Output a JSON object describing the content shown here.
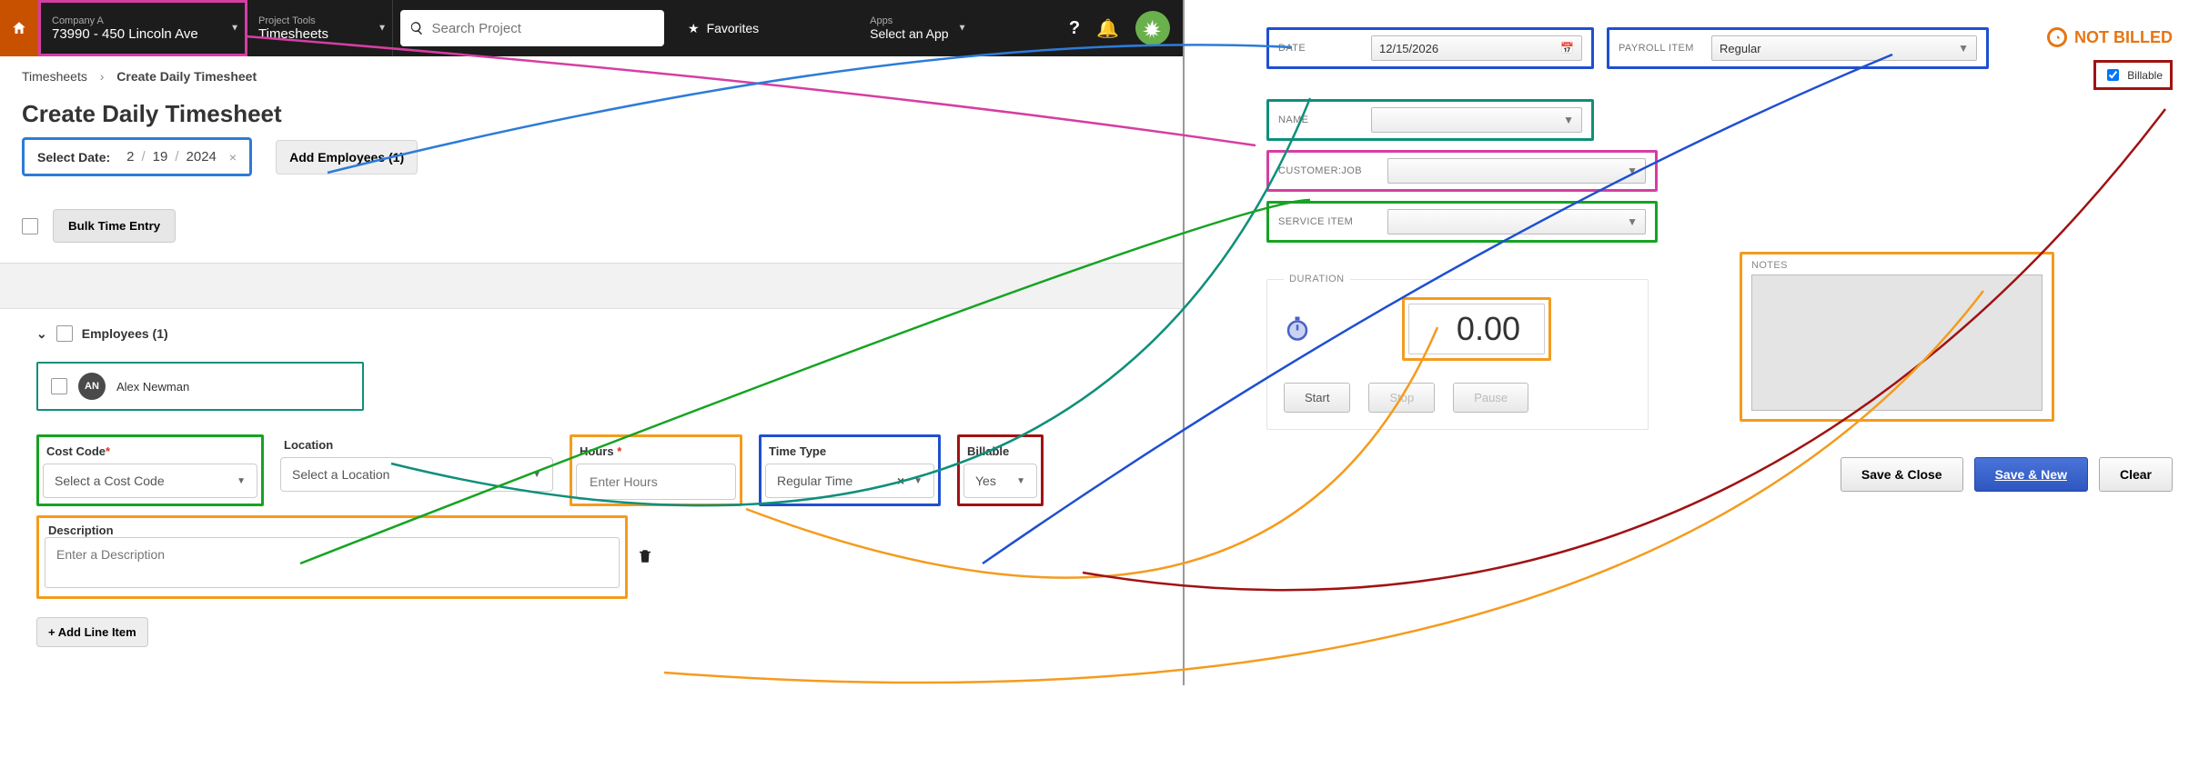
{
  "nav": {
    "company": {
      "small": "Company A",
      "big": "73990 - 450 Lincoln Ave"
    },
    "tools": {
      "small": "Project Tools",
      "big": "Timesheets"
    },
    "search_placeholder": "Search Project",
    "favorites": "Favorites",
    "apps": {
      "small": "Apps",
      "big": "Select an App"
    }
  },
  "crumb": {
    "root": "Timesheets",
    "current": "Create Daily Timesheet"
  },
  "page": {
    "title": "Create Daily Timesheet",
    "select_date_label": "Select Date:",
    "date_m": "2",
    "date_d": "19",
    "date_y": "2024",
    "add_employees": "Add Employees (1)",
    "bulk_entry": "Bulk Time Entry",
    "employees_header": "Employees (1)",
    "employee": {
      "initials": "AN",
      "name": "Alex Newman"
    },
    "fields": {
      "cost_code": {
        "label": "Cost Code",
        "placeholder": "Select a Cost Code"
      },
      "location": {
        "label": "Location",
        "placeholder": "Select a Location"
      },
      "hours": {
        "label": "Hours",
        "placeholder": "Enter Hours"
      },
      "time_type": {
        "label": "Time Type",
        "value": "Regular Time"
      },
      "billable": {
        "label": "Billable",
        "value": "Yes"
      },
      "description": {
        "label": "Description",
        "placeholder": "Enter a Description"
      }
    },
    "add_line": "+ Add Line Item"
  },
  "rform": {
    "date": {
      "label": "DATE",
      "value": "12/15/2026"
    },
    "payroll": {
      "label": "PAYROLL ITEM",
      "value": "Regular"
    },
    "not_billed": "NOT BILLED",
    "billable_label": "Billable",
    "name": {
      "label": "NAME"
    },
    "customer": {
      "label": "CUSTOMER:JOB"
    },
    "service": {
      "label": "SERVICE ITEM"
    },
    "duration": {
      "label": "DURATION",
      "value": "0.00",
      "start": "Start",
      "stop": "Stop",
      "pause": "Pause"
    },
    "notes_label": "NOTES",
    "actions": {
      "save_close": "Save & Close",
      "save_new": "Save & New",
      "clear": "Clear"
    }
  }
}
